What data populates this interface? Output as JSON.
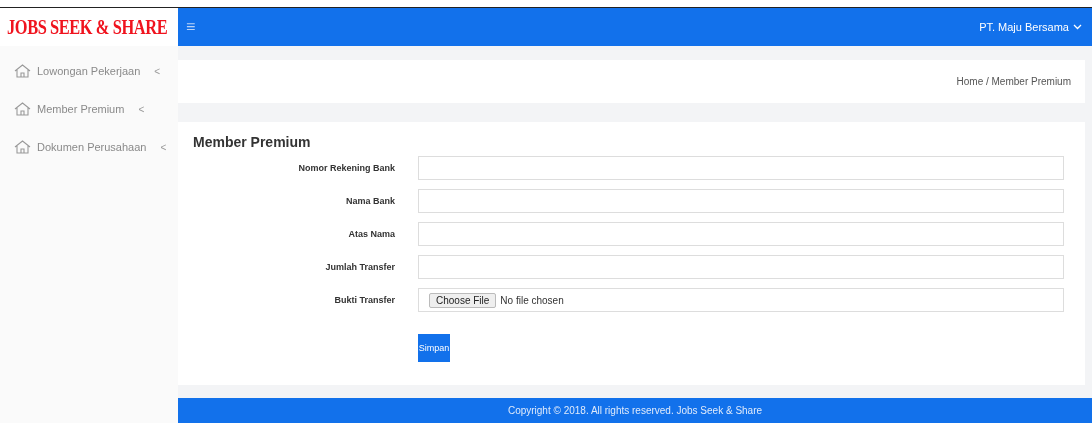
{
  "brand": {
    "logo": "JOBS SEEK & SHARE"
  },
  "header": {
    "menu_glyph": "≡",
    "user": "PT. Maju Bersama"
  },
  "sidebar": {
    "items": [
      {
        "label": "Lowongan Pekerjaan",
        "chevron": "<"
      },
      {
        "label": "Member Premium",
        "chevron": "<"
      },
      {
        "label": "Dokumen Perusahaan",
        "chevron": "<"
      }
    ]
  },
  "breadcrumb": "Home / Member Premium",
  "form": {
    "title": "Member Premium",
    "fields": [
      {
        "kind": "text",
        "label": "Nomor Rekening Bank"
      },
      {
        "kind": "text",
        "label": "Nama Bank"
      },
      {
        "kind": "text",
        "label": "Atas Nama"
      },
      {
        "kind": "text",
        "label": "Jumlah Transfer"
      },
      {
        "kind": "file",
        "label": "Bukti Transfer",
        "button": "Choose File",
        "status": "No file chosen"
      }
    ],
    "submit": "Simpan"
  },
  "footer": "Copyright © 2018. All rights reserved. Jobs Seek & Share"
}
